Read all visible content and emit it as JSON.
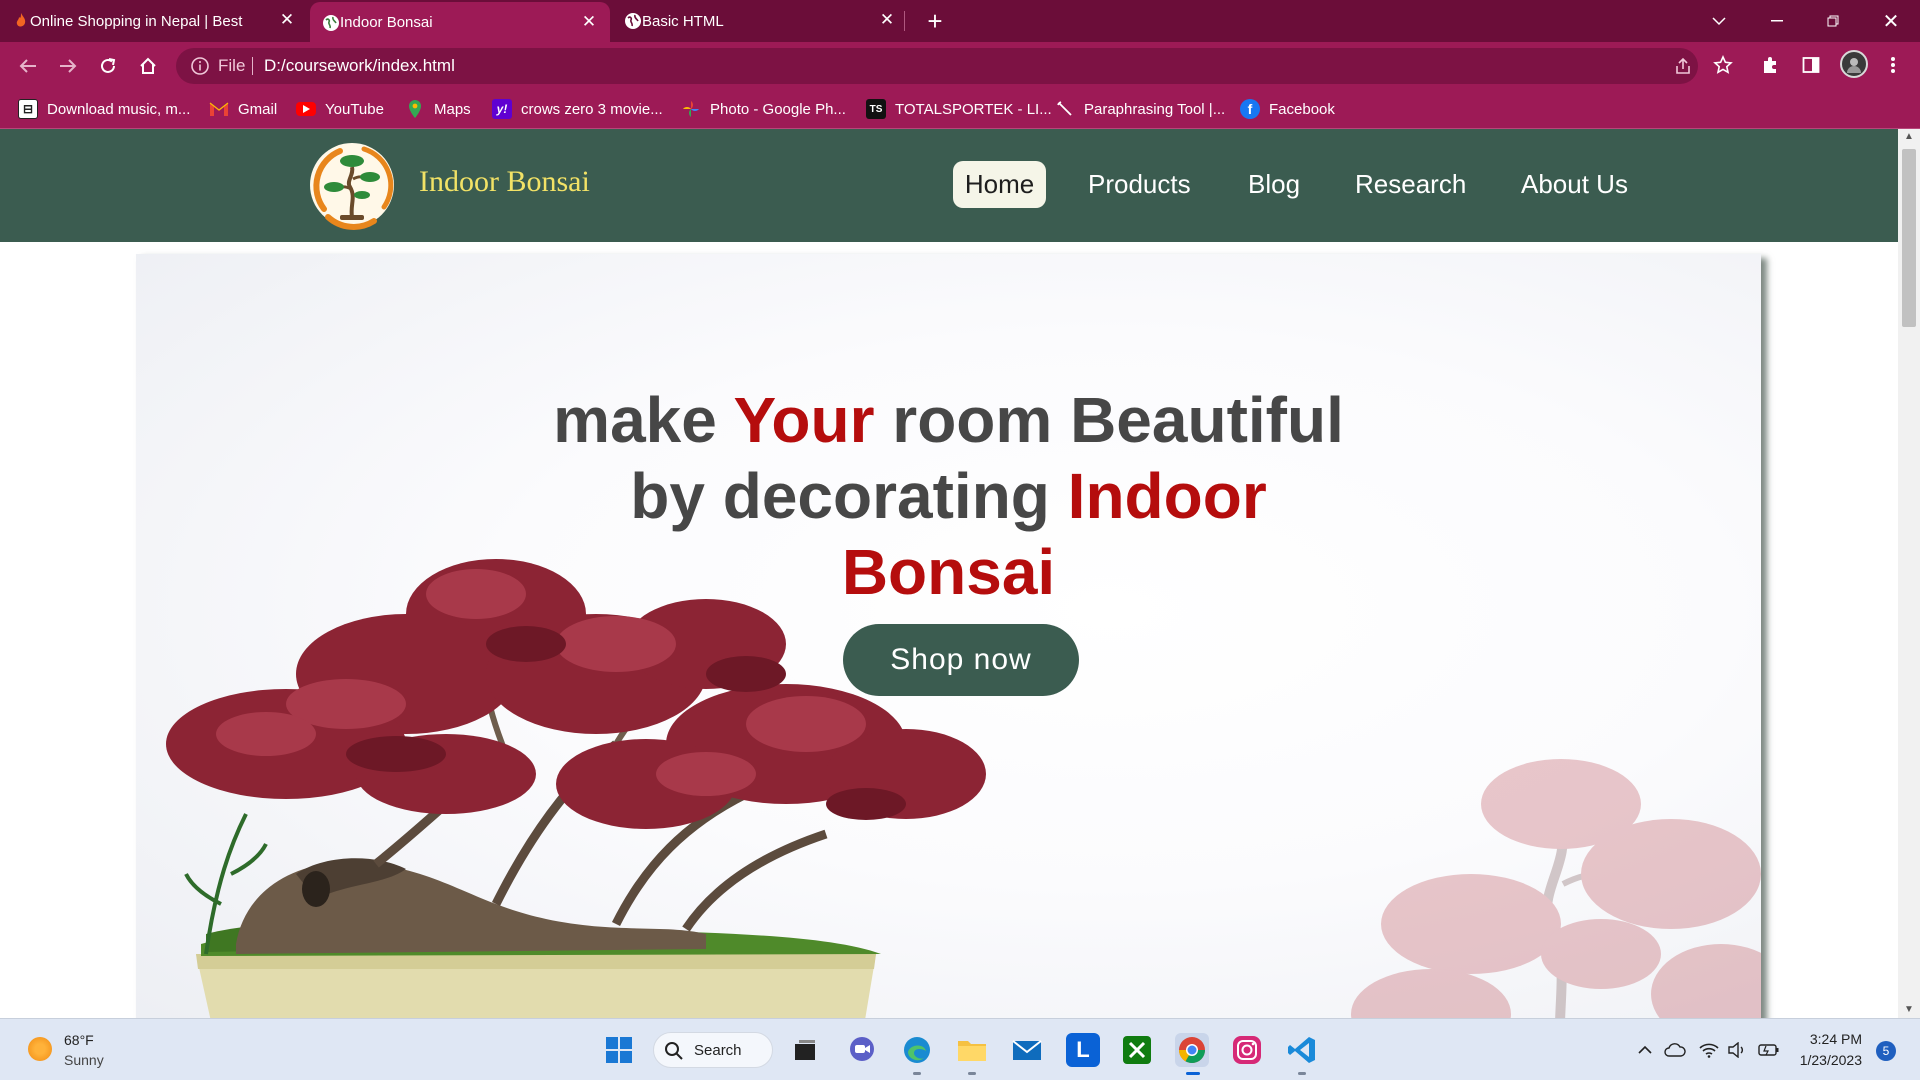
{
  "browser": {
    "tabs": [
      {
        "title": "Online Shopping in Nepal | Best",
        "favicon": "fire-icon",
        "active": false
      },
      {
        "title": "Indoor Bonsai",
        "favicon": "globe-icon",
        "active": true
      },
      {
        "title": "Basic HTML",
        "favicon": "globe-icon",
        "active": false
      }
    ],
    "address": {
      "scheme": "File",
      "url": "D:/coursework/index.html"
    },
    "bookmarks": [
      {
        "label": "Download music, m...",
        "icon": "download-icon"
      },
      {
        "label": "Gmail",
        "icon": "gmail-icon"
      },
      {
        "label": "YouTube",
        "icon": "youtube-icon"
      },
      {
        "label": "Maps",
        "icon": "maps-icon"
      },
      {
        "label": "crows zero 3 movie...",
        "icon": "yahoo-icon"
      },
      {
        "label": "Photo - Google Ph...",
        "icon": "google-photos-icon"
      },
      {
        "label": "TOTALSPORTEK - LI...",
        "icon": "totalsportek-icon"
      },
      {
        "label": "Paraphrasing Tool |...",
        "icon": "pen-icon"
      },
      {
        "label": "Facebook",
        "icon": "facebook-icon"
      }
    ]
  },
  "site": {
    "brand": "Indoor Bonsai",
    "menu": {
      "home": "Home",
      "products": "Products",
      "blog": "Blog",
      "research": "Research",
      "about": "About Us"
    },
    "hero": {
      "w1": "make ",
      "w2": "Your",
      "w3": " room Beautiful",
      "w4": "by decorating ",
      "w5": "Indoor",
      "w6": "Bonsai",
      "button": "Shop now"
    },
    "colors": {
      "nav": "#3b5c50",
      "brand": "#f2e266",
      "highlight": "#b50d0d",
      "chrome": "#9d1a56"
    }
  },
  "taskbar": {
    "weather": {
      "temp": "68°F",
      "condition": "Sunny"
    },
    "search_label": "Search",
    "time": "3:24 PM",
    "date": "1/23/2023",
    "notifications": "5"
  }
}
